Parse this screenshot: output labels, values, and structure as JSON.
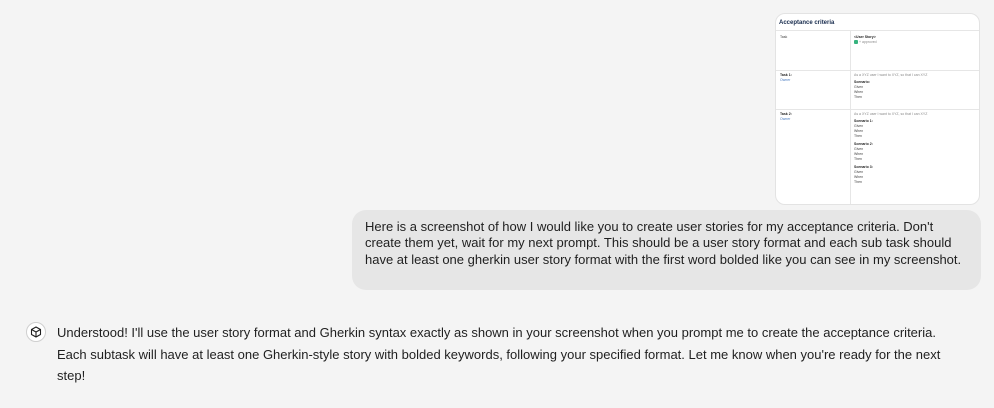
{
  "attachment": {
    "title": "Acceptance criteria",
    "rows": [
      {
        "left": [
          "Task"
        ],
        "right": [
          "<User Story>",
          "+ approved"
        ]
      },
      {
        "left": [
          "Task 1:",
          "Owner"
        ],
        "right": [
          "As a XYZ user I want to XYZ, so that I can XYZ",
          "Scenario:",
          "Given",
          "When",
          "Then"
        ]
      },
      {
        "left": [
          "Task 2:",
          "Owner"
        ],
        "right": [
          "As a XYZ user I want to XYZ, so that I can XYZ",
          "Scenario 1:",
          "Given",
          "When",
          "Then",
          "Scenario 2:",
          "Given",
          "When",
          "Then",
          "Scenario 3:",
          "Given",
          "When",
          "Then"
        ]
      }
    ]
  },
  "user_message": "Here is a screenshot of how I would like you to create user stories for my acceptance criteria. Don't create them yet, wait for my next prompt. This should be a user story format and each sub task should have at least one gherkin user story format with the first word bolded like you can see in my screenshot.",
  "assistant_message": "Understood! I'll use the user story format and Gherkin syntax exactly as shown in your screenshot when you prompt me to create the acceptance criteria. Each subtask will have at least one Gherkin-style story with bolded keywords, following your specified format. Let me know when you're ready for the next step!",
  "icons": {
    "assistant_avatar": "cube-icon"
  },
  "colors": {
    "background": "#f4f4f4",
    "user_bubble": "#e6e6e6",
    "text": "#1f1f1f"
  }
}
